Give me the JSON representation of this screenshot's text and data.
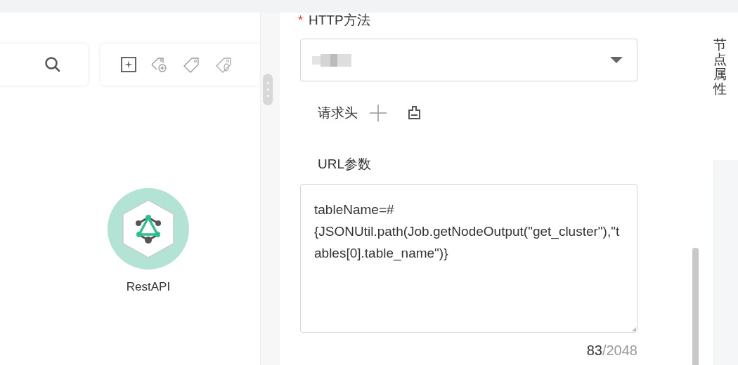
{
  "canvas": {
    "node": {
      "label": "RestAPI"
    }
  },
  "form": {
    "http_method": {
      "label": "HTTP方法",
      "required": true,
      "required_mark": "*"
    },
    "request_headers": {
      "label": "请求头"
    },
    "url_params": {
      "label": "URL参数",
      "value": "tableName=#{JSONUtil.path(Job.getNodeOutput(\"get_cluster\"),\"tables[0].table_name\")}",
      "count": "83",
      "limit": "/2048"
    }
  },
  "side_tab": {
    "label": "节点属性"
  }
}
